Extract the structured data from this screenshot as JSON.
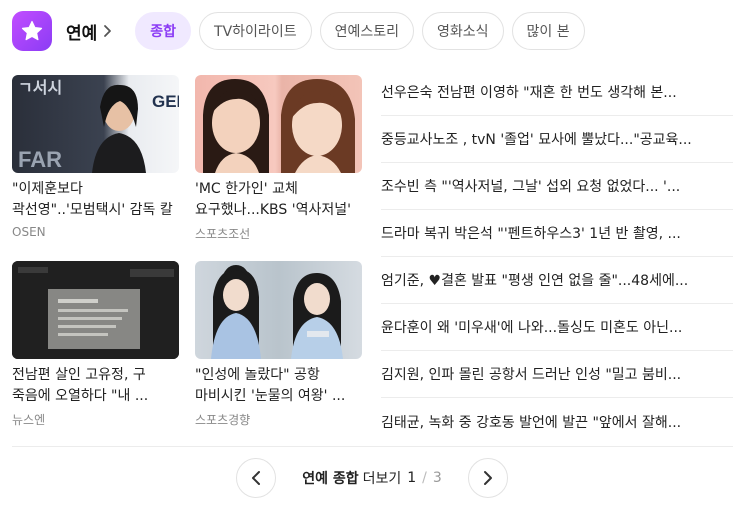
{
  "header": {
    "section_label": "연예",
    "tabs": [
      {
        "label": "종합",
        "active": true
      },
      {
        "label": "TV하이라이트",
        "active": false
      },
      {
        "label": "연예스토리",
        "active": false
      },
      {
        "label": "영화소식",
        "active": false
      },
      {
        "label": "많이 본",
        "active": false
      }
    ]
  },
  "cards": [
    {
      "title": "\"이제훈보다 곽선영\"..'모범택시' 감독 칼 갈고 ...",
      "press": "OSEN",
      "thumb_text": "GEN"
    },
    {
      "title": "'MC 한가인' 교체 요구했나...KBS '역사저널' ...",
      "press": "스포츠조선"
    },
    {
      "title": "전남편 살인 고유정, 구 죽음에 오열하다 \"내 ...",
      "press": "뉴스엔"
    },
    {
      "title": "\"인성에 놀랐다\" 공항 마비시킨 '눈물의 여왕' ...",
      "press": "스포츠경향"
    }
  ],
  "news_list": [
    "선우은숙 전남편 이영하 \"재혼 한 번도 생각해 본...",
    "중등교사노조 , tvN '졸업' 묘사에 뿔났다...\"공교육...",
    "조수빈 측 \"'역사저널, 그날' 섭외 요청 없었다... '...",
    "드라마 복귀 박은석 \"'펜트하우스3' 1년 반 촬영, ...",
    "엄기준, ♥결혼 발표 \"평생 인연 없을 줄\"...48세에...",
    "윤다훈이 왜 '미우새'에 나와...돌싱도 미혼도 아닌...",
    "김지원, 인파 몰린 공항서 드러난 인성 \"밀고 붐비...",
    "김태균, 녹화 중 강호동 발언에 발끈 \"앞에서 잘해..."
  ],
  "footer": {
    "more_strong": "연예 종합",
    "more_label": "더보기",
    "current_page": "1",
    "separator": "/",
    "total_pages": "3"
  },
  "colors": {
    "accent": "#8b3cf5",
    "accent_bg": "#f0e9ff",
    "text": "#222222",
    "muted": "#888888",
    "border": "#e2e2e2"
  },
  "icons": {
    "logo": "star-icon",
    "section_more": "chevron-right-icon",
    "prev": "chevron-left-icon",
    "next": "chevron-right-icon"
  }
}
